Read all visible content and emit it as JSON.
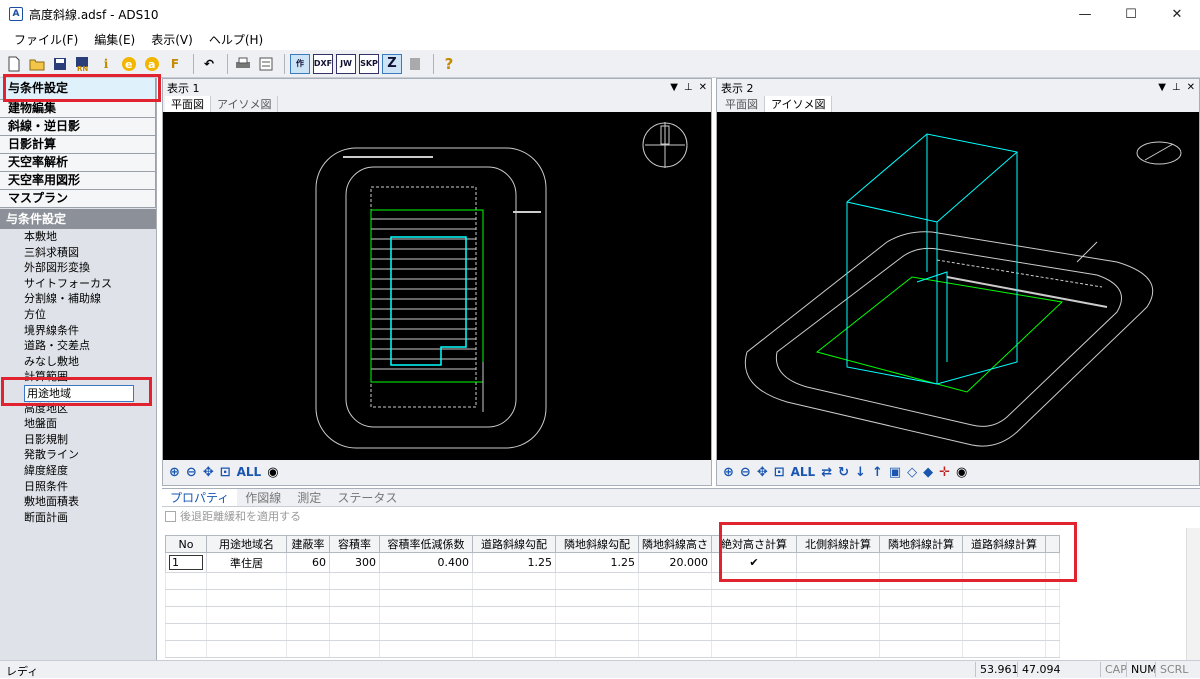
{
  "window": {
    "title": "高度斜線.adsf - ADS10",
    "min": "—",
    "max": "☐",
    "close": "✕"
  },
  "menu": [
    "ファイル(F)",
    "編集(E)",
    "表示(V)",
    "ヘルプ(H)"
  ],
  "toolbar": {
    "box_labels": [
      "作",
      "DXF",
      "JW",
      "SKP",
      "Z"
    ],
    "help": "?"
  },
  "left": {
    "categories": [
      "与条件設定",
      "建物編集",
      "斜線・逆日影",
      "日影計算",
      "天空率解析",
      "天空率用図形",
      "マスプラン"
    ],
    "section": "与条件設定",
    "items": [
      "本敷地",
      "三斜求積図",
      "外部図形変換",
      "サイトフォーカス",
      "分割線・補助線",
      "方位",
      "境界線条件",
      "道路・交差点",
      "みなし敷地",
      "計算範囲",
      "用途地域",
      "高度地区",
      "地盤面",
      "日影規制",
      "発散ライン",
      "緯度経度",
      "日照条件",
      "敷地面積表",
      "断面計画"
    ],
    "selected_item": "用途地域"
  },
  "view1": {
    "title": "表示 1",
    "tabs": [
      "平面図",
      "アイソメ図"
    ],
    "active_tab": "平面図",
    "all": "ALL"
  },
  "view2": {
    "title": "表示 2",
    "tabs": [
      "平面図",
      "アイソメ図"
    ],
    "active_tab": "アイソメ図",
    "all": "ALL"
  },
  "props": {
    "tabs": [
      "プロパティ",
      "作図線",
      "測定",
      "ステータス"
    ],
    "checkbox_label": "後退距離緩和を適用する",
    "columns": [
      "No",
      "用途地域名",
      "建蔽率",
      "容積率",
      "容積率低減係数",
      "道路斜線勾配",
      "隣地斜線勾配",
      "隣地斜線高さ",
      "絶対高さ計算",
      "北側斜線計算",
      "隣地斜線計算",
      "道路斜線計算"
    ],
    "row": [
      "1",
      "準住居",
      "60",
      "300",
      "0.400",
      "1.25",
      "1.25",
      "20.000",
      "✔",
      "",
      "",
      ""
    ]
  },
  "status": {
    "left": "レディ",
    "x": "53.961",
    "y": "47.094",
    "cap": "CAP",
    "num": "NUM",
    "scrl": "SCRL"
  },
  "colors": {
    "highlight": "#e0232f",
    "accent": "#1a56b0",
    "canvas": "#000000",
    "building": "#00ffff",
    "site": "#00ff00"
  }
}
